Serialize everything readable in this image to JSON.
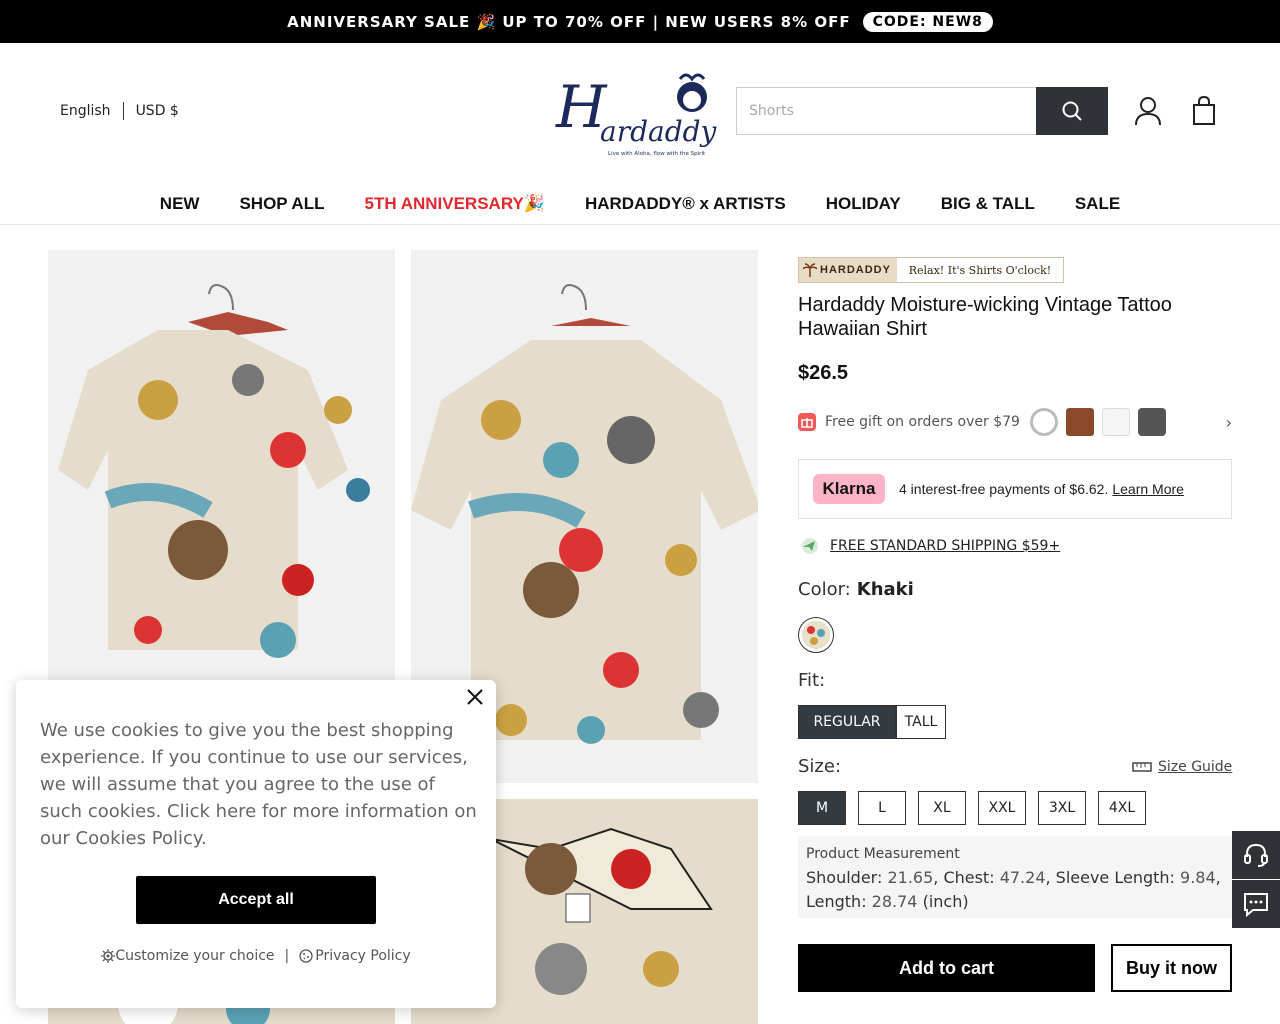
{
  "announcement": {
    "text": "ANNIVERSARY SALE 🎉 UP TO 70% OFF | NEW USERS 8% OFF",
    "code": "CODE: NEW8"
  },
  "header": {
    "language": "English",
    "currency": "USD $",
    "logo_text": "Hardaddy",
    "logo_tagline": "Live with Aloha, flow with the Spirit",
    "search_placeholder": "Shorts"
  },
  "nav": [
    {
      "label": "NEW",
      "color": "#111111"
    },
    {
      "label": "SHOP ALL",
      "color": "#111111"
    },
    {
      "label": "5TH ANNIVERSARY🎉",
      "color": "#e0282e"
    },
    {
      "label": "HARDADDY® x ARTISTS",
      "color": "#111111"
    },
    {
      "label": "HOLIDAY",
      "color": "#111111"
    },
    {
      "label": "BIG & TALL",
      "color": "#111111"
    },
    {
      "label": "SALE",
      "color": "#111111"
    }
  ],
  "product": {
    "brand_badge": "HARDADDY",
    "brand_slogan": "Relax! It's Shirts O'clock!",
    "title": "Hardaddy Moisture-wicking Vintage Tattoo Hawaiian Shirt",
    "price": "$26.5",
    "gift_text": "Free gift on orders over $79",
    "klarna": {
      "logo": "Klarna",
      "text": "4 interest-free payments of $6.62.",
      "link": "Learn More"
    },
    "shipping": "FREE STANDARD SHIPPING $59+",
    "color_label": "Color:",
    "color_value": "Khaki",
    "fit_label": "Fit:",
    "fits": [
      {
        "label": "REGULAR",
        "selected": true
      },
      {
        "label": "TALL",
        "selected": false
      }
    ],
    "size_label": "Size:",
    "size_guide": "Size Guide",
    "sizes": [
      {
        "label": "M",
        "selected": true
      },
      {
        "label": "L",
        "selected": false
      },
      {
        "label": "XL",
        "selected": false
      },
      {
        "label": "XXL",
        "selected": false
      },
      {
        "label": "3XL",
        "selected": false
      },
      {
        "label": "4XL",
        "selected": false
      }
    ],
    "measurement": {
      "heading": "Product Measurement",
      "shoulder_label": "Shoulder:",
      "shoulder": "21.65",
      "chest_label": "Chest:",
      "chest": "47.24",
      "sleeve_label": "Sleeve Length:",
      "sleeve": "9.84",
      "length_label": "Length:",
      "length": "28.74",
      "unit": "(inch)"
    },
    "add_to_cart": "Add to cart",
    "buy_now": "Buy it now"
  },
  "cookie": {
    "message": "We use cookies to give you the best shopping experience. If you continue to use our services, we will assume that you agree to the use of such cookies. Click here for more information on our Cookies Policy.",
    "accept": "Accept all",
    "customize": "Customize your choice",
    "separator": "|",
    "privacy": "Privacy Policy"
  },
  "icons": [
    "search-icon",
    "user-icon",
    "bag-icon",
    "gift-icon",
    "chevron-right-icon",
    "shipping-icon",
    "ruler-icon",
    "headset-icon",
    "chat-icon",
    "close-icon",
    "gear-icon",
    "cookie-icon"
  ]
}
